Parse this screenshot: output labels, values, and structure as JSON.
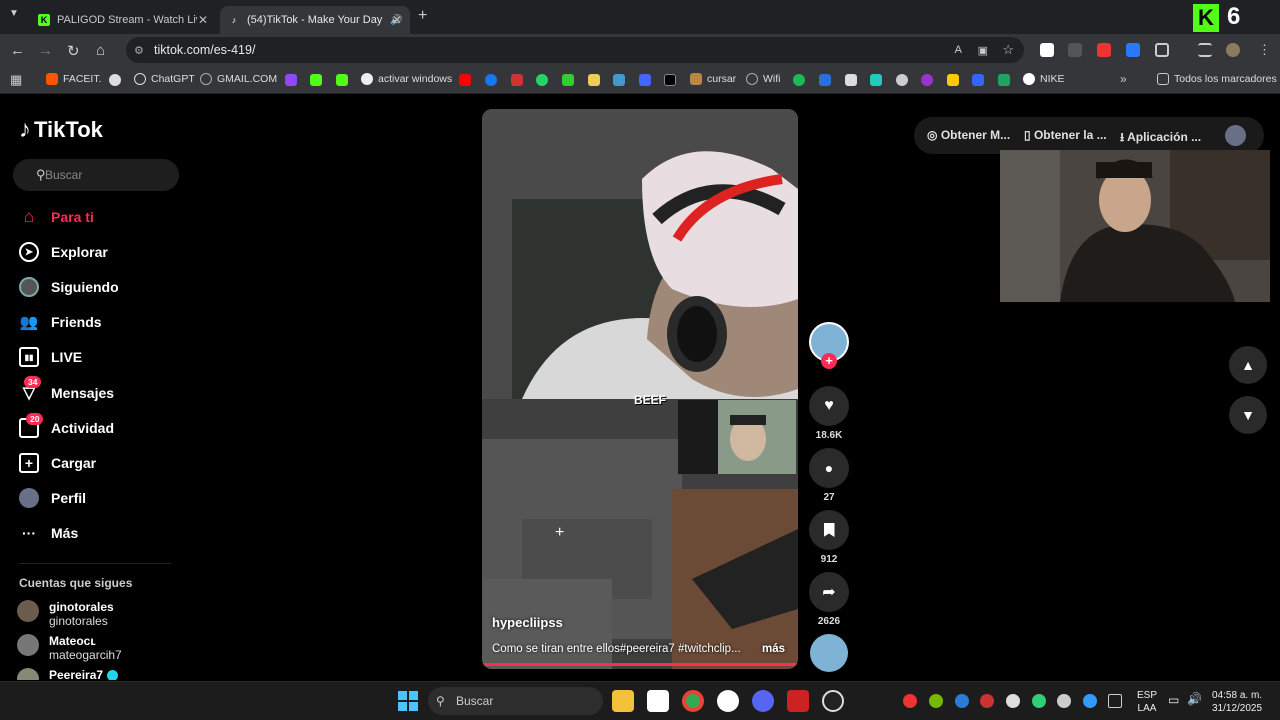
{
  "browser": {
    "tabs": [
      {
        "label": "PALIGOD Stream - Watch Live c"
      },
      {
        "label": "(54)TikTok - Make Your Day"
      }
    ],
    "url": "tiktok.com/es-419/",
    "bookmarks": [
      "FACEIT.",
      "ChatGPT",
      "GMAIL.COM",
      "activar windows",
      "cursar",
      "Wifi",
      "NIKE"
    ],
    "all_bookmarks": "Todos los marcadores",
    "kick_badge": "6"
  },
  "tiktok": {
    "logo": "TikTok",
    "search_placeholder": "Buscar",
    "nav": [
      {
        "label": "Para ti",
        "icon": "home-icon",
        "active": true
      },
      {
        "label": "Explorar",
        "icon": "compass-icon"
      },
      {
        "label": "Siguiendo",
        "icon": "following-icon"
      },
      {
        "label": "Friends",
        "icon": "friends-icon"
      },
      {
        "label": "LIVE",
        "icon": "live-icon"
      },
      {
        "label": "Mensajes",
        "icon": "messages-icon",
        "badge": "34"
      },
      {
        "label": "Actividad",
        "icon": "activity-icon",
        "badge": "20"
      },
      {
        "label": "Cargar",
        "icon": "upload-icon"
      },
      {
        "label": "Perfil",
        "icon": "profile-icon"
      },
      {
        "label": "Más",
        "icon": "more-icon"
      }
    ],
    "following_header": "Cuentas que sigues",
    "following": [
      {
        "name": "ginotorales",
        "handle": "ginotorales"
      },
      {
        "name": "Mateoᴄʟ",
        "handle": "mateogarcih7"
      },
      {
        "name": "Peereira7",
        "handle": ""
      }
    ],
    "video": {
      "author": "hypecliipss",
      "caption": "Como se tiran entre ellos#peereira7 #twitchclip...",
      "more": "más",
      "overlay_text": "BEEF"
    },
    "actions": {
      "likes": "18.6K",
      "comments": "27",
      "saves": "912",
      "shares": "2626"
    },
    "top_buttons": [
      "Obtener M...",
      "Obtener la ...",
      "Aplicación ..."
    ]
  },
  "taskbar": {
    "search": "Buscar",
    "lang1": "ESP",
    "lang2": "LAA",
    "time": "04:58 a. m.",
    "date": "31/12/2025"
  }
}
